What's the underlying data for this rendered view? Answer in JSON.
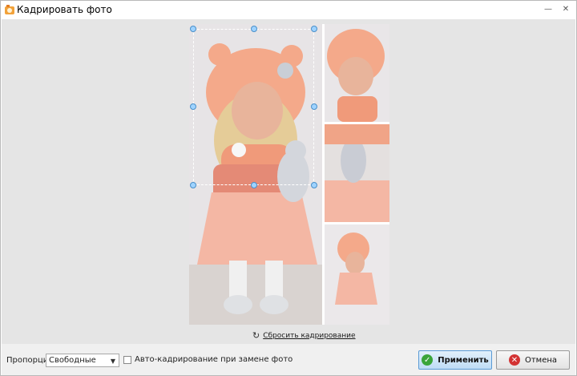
{
  "window": {
    "title": "Кадрировать фото",
    "controls": {
      "minimize": "—",
      "close": "✕"
    }
  },
  "toolbar": {
    "reset_label": "Сбросить кадрирование"
  },
  "bottom": {
    "proportions_label": "Пропорции:",
    "proportions_value": "Свободные",
    "auto_crop_label": "Авто-кадрирование при замене фото",
    "auto_crop_checked": false,
    "apply_label": "Применить",
    "cancel_label": "Отмена"
  },
  "colors": {
    "handle": "#9fd3ff",
    "apply_icon": "#3aa53a",
    "cancel_icon": "#d33333"
  }
}
